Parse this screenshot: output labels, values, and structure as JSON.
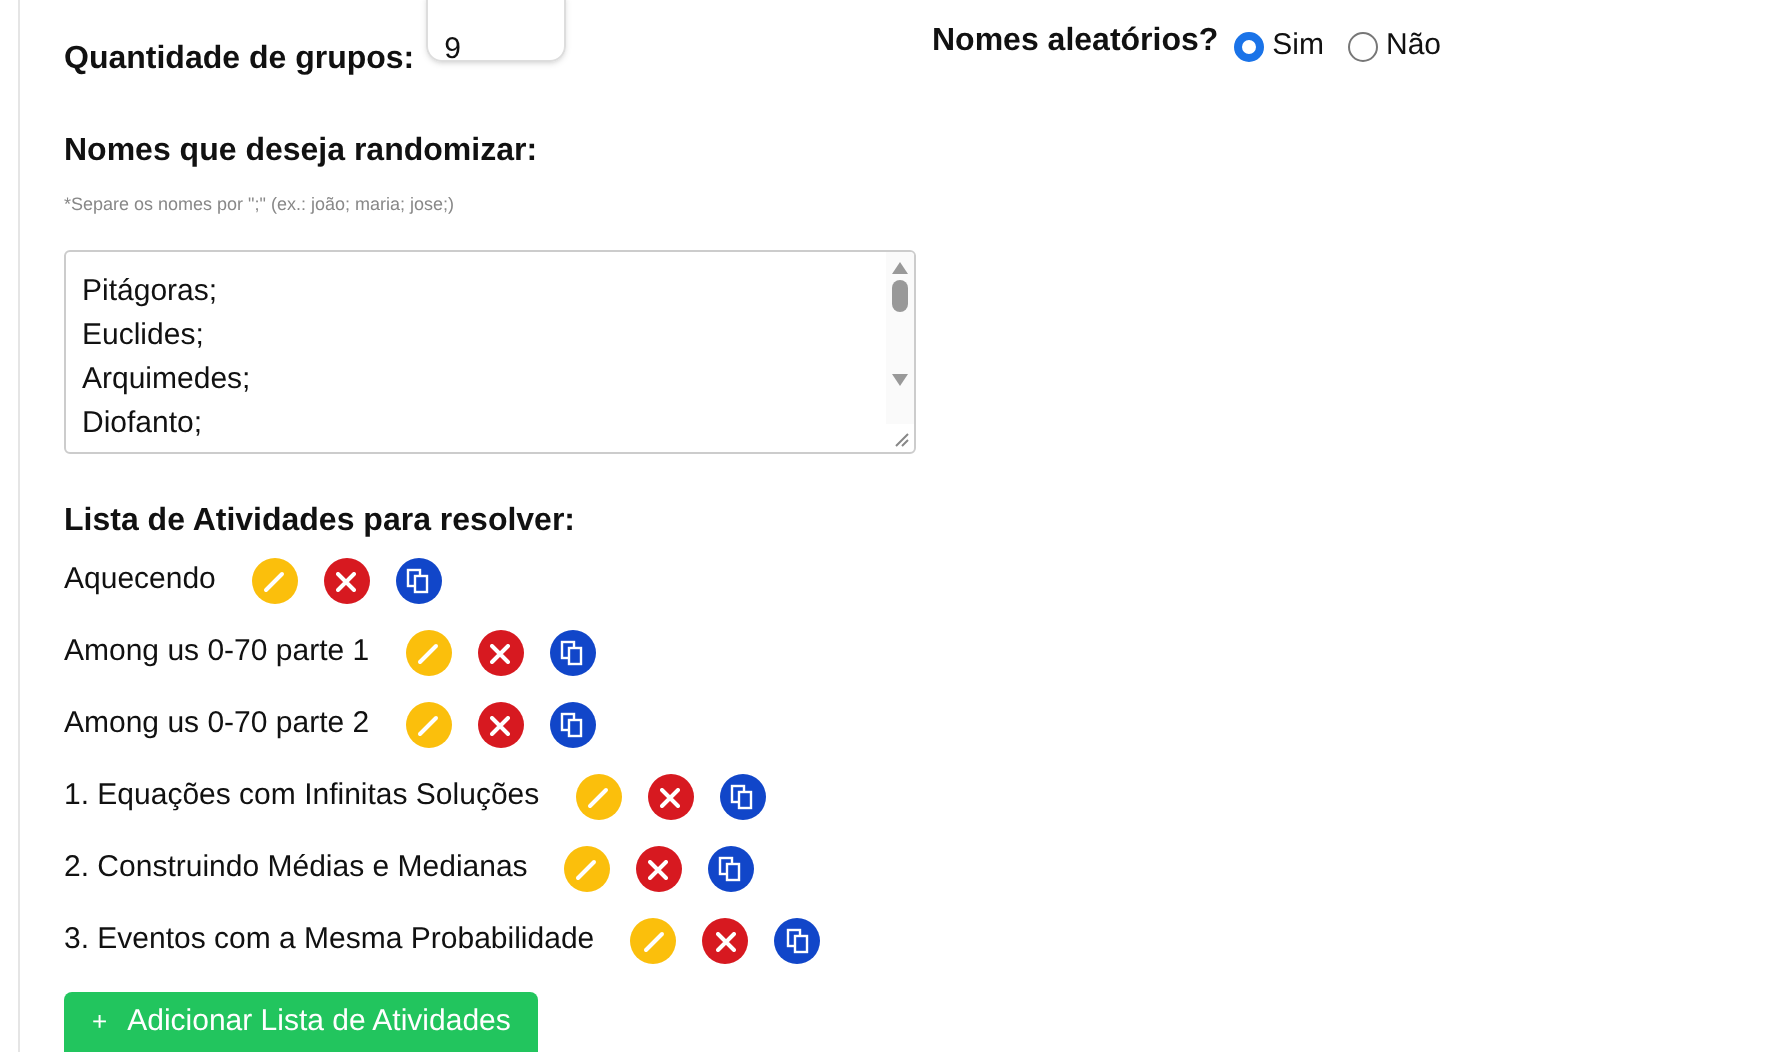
{
  "group_count": {
    "label": "Quantidade de grupos:",
    "value": "9"
  },
  "random_names": {
    "label": "Nomes aleatórios?",
    "options": [
      {
        "label": "Sim",
        "selected": true
      },
      {
        "label": "Não",
        "selected": false
      }
    ]
  },
  "names": {
    "label": "Nomes que deseja randomizar:",
    "hint": "*Separe os nomes por \";\" (ex.: joão; maria; jose;)",
    "lines": [
      "Pitágoras;",
      "Euclides;",
      "Arquimedes;",
      "Diofanto;"
    ]
  },
  "activities": {
    "label": "Lista de Atividades para resolver:",
    "items": [
      {
        "name": "Aquecendo"
      },
      {
        "name": "Among us 0-70 parte 1"
      },
      {
        "name": "Among us 0-70 parte 2"
      },
      {
        "name": "1. Equações com Infinitas Soluções"
      },
      {
        "name": "2. Construindo Médias e Medianas"
      },
      {
        "name": "3. Eventos com a Mesma Probabilidade"
      }
    ]
  },
  "add_button": {
    "icon": "+",
    "label": "Adicionar Lista de Atividades"
  }
}
